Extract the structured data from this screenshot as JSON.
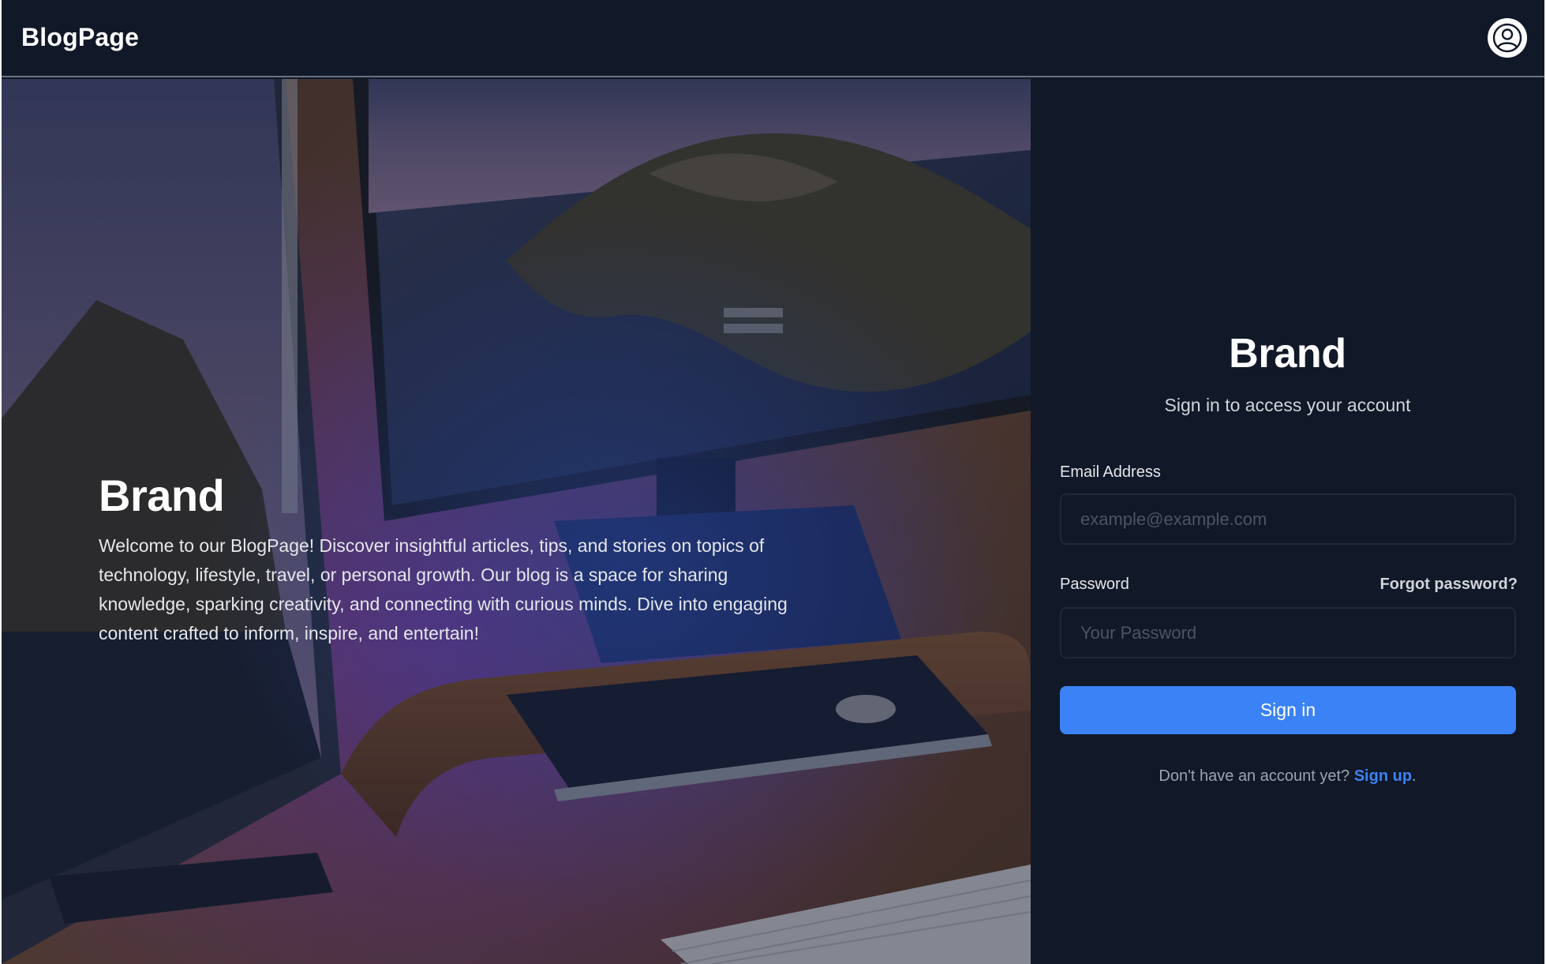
{
  "navbar": {
    "brand": "BlogPage",
    "avatar_icon": "user-circle-icon"
  },
  "hero": {
    "title": "Brand",
    "description": "Welcome to our BlogPage! Discover insightful articles, tips, and stories on topics of technology, lifestyle, travel, or personal growth. Our blog is a space for sharing knowledge, sparking creativity, and connecting with curious minds. Dive into engaging content crafted to inform, inspire, and entertain!"
  },
  "signin": {
    "title": "Brand",
    "subtitle": "Sign in to access your account",
    "email_label": "Email Address",
    "email_placeholder": "example@example.com",
    "email_value": "",
    "password_label": "Password",
    "password_placeholder": "Your Password",
    "password_value": "",
    "forgot_label": "Forgot password?",
    "submit_label": "Sign in",
    "signup_prompt": "Don't have an account yet? ",
    "signup_label": "Sign up",
    "signup_suffix": "."
  },
  "colors": {
    "background": "#111827",
    "accent": "#3b82f6",
    "border": "#1f2937"
  }
}
